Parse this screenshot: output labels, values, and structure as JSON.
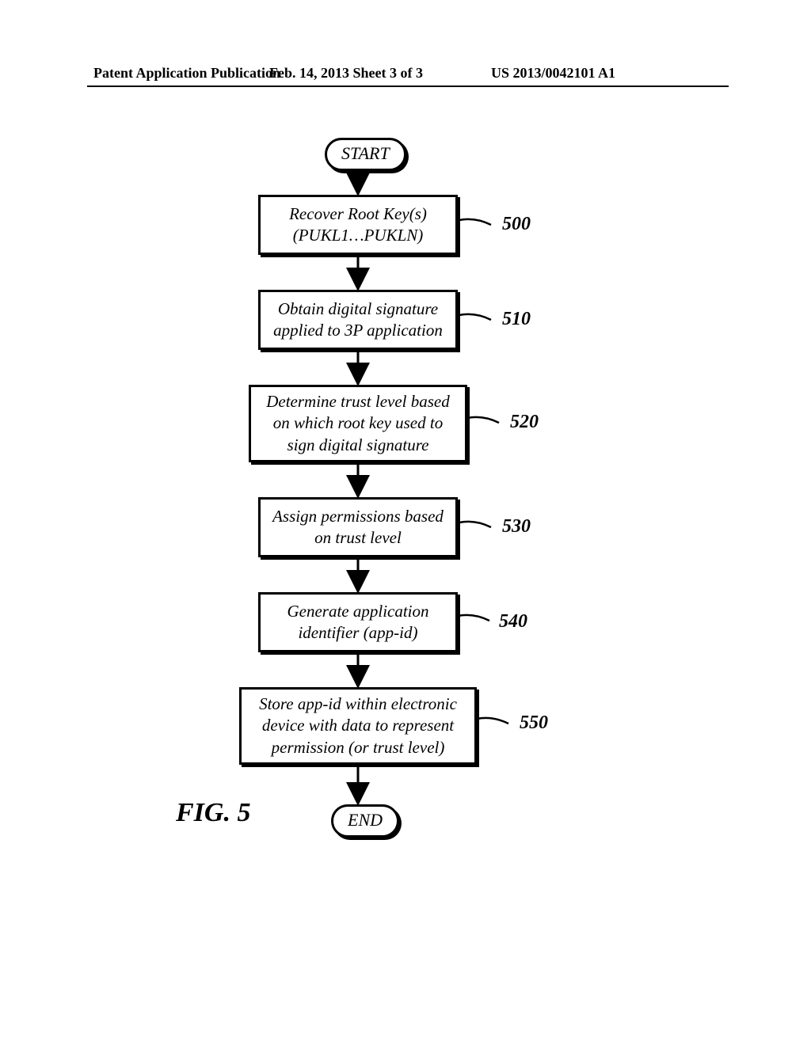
{
  "header": {
    "left": "Patent Application Publication",
    "mid": "Feb. 14, 2013  Sheet 3 of 3",
    "right": "US 2013/0042101 A1"
  },
  "chart_data": {
    "type": "flowchart",
    "direction": "top-to-bottom",
    "title": "FIG. 5",
    "nodes": [
      {
        "id": "start",
        "shape": "terminal",
        "text": "START"
      },
      {
        "id": "n500",
        "shape": "process",
        "text": "Recover Root Key(s)\n(PUKL1...PUKLN)",
        "ref": "500"
      },
      {
        "id": "n510",
        "shape": "process",
        "text": "Obtain digital signature\napplied to 3P application",
        "ref": "510"
      },
      {
        "id": "n520",
        "shape": "process",
        "text": "Determine trust level based\non which root key used to\nsign digital signature",
        "ref": "520"
      },
      {
        "id": "n530",
        "shape": "process",
        "text": "Assign permissions based\non trust level",
        "ref": "530"
      },
      {
        "id": "n540",
        "shape": "process",
        "text": "Generate application\nidentifier (app-id)",
        "ref": "540"
      },
      {
        "id": "n550",
        "shape": "process",
        "text": "Store app-id within electronic\ndevice with data to represent\npermission (or trust level)",
        "ref": "550"
      },
      {
        "id": "end",
        "shape": "terminal",
        "text": "END"
      }
    ],
    "edges": [
      [
        "start",
        "n500"
      ],
      [
        "n500",
        "n510"
      ],
      [
        "n510",
        "n520"
      ],
      [
        "n520",
        "n530"
      ],
      [
        "n530",
        "n540"
      ],
      [
        "n540",
        "n550"
      ],
      [
        "n550",
        "end"
      ]
    ]
  },
  "fig": {
    "start": "START",
    "end": "END",
    "label": "FIG. 5",
    "b500": {
      "text": "Recover Root Key(s)<br>(PUKL1…PUKLN)",
      "ref": "500"
    },
    "b510": {
      "text": "Obtain digital signature<br>applied to 3P application",
      "ref": "510"
    },
    "b520": {
      "text": "Determine trust level based<br>on which root key used to<br>sign digital signature",
      "ref": "520"
    },
    "b530": {
      "text": "Assign permissions based<br>on trust level",
      "ref": "530"
    },
    "b540": {
      "text": "Generate application<br>identifier (app-id)",
      "ref": "540"
    },
    "b550": {
      "text": "Store app-id within electronic<br>device with data to represent<br>permission (or trust level)",
      "ref": "550"
    }
  }
}
